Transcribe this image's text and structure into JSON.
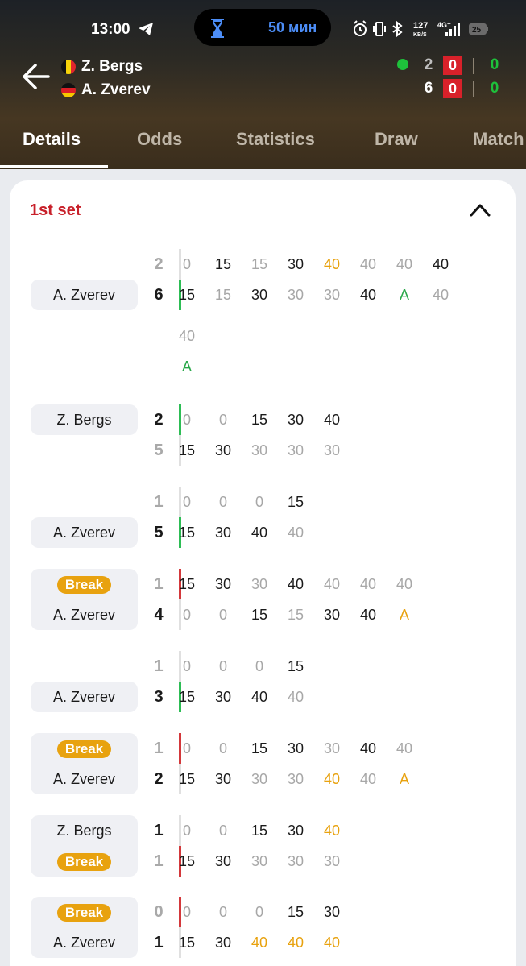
{
  "status_bar": {
    "time": "13:00",
    "timer_text": "50 мин",
    "network_speed": "127",
    "network_unit": "KB/S",
    "network_type": "4G⁺",
    "battery": "25",
    "icons": [
      "telegram-icon",
      "hourglass-icon",
      "alarm-icon",
      "vibrate-icon",
      "bluetooth-icon",
      "signal-icon",
      "battery-icon"
    ]
  },
  "match_header": {
    "back_icon": "arrow-left-icon",
    "players": [
      {
        "name": "Z. Bergs",
        "flag": "belgium-flag-icon",
        "flag_colors": [
          "#111111",
          "#f6d20a",
          "#e1262d"
        ],
        "sets": "2",
        "current_game": "0",
        "points": "0",
        "serving": true
      },
      {
        "name": "A. Zverev",
        "flag": "germany-flag-icon",
        "flag_colors": [
          "#111111",
          "#dd1f26",
          "#f6c800"
        ],
        "sets": "6",
        "current_game": "0",
        "points": "0",
        "serving": false
      }
    ]
  },
  "tabs": [
    {
      "label": "Details",
      "active": true
    },
    {
      "label": "Odds",
      "active": false
    },
    {
      "label": "Statistics",
      "active": false
    },
    {
      "label": "Draw",
      "active": false
    },
    {
      "label": "Match",
      "active": false
    }
  ],
  "set_section": {
    "title": "1st set",
    "collapse_icon": "chevron-up-icon",
    "break_label": "Break",
    "games": [
      {
        "top_label": "",
        "bottom_label": "A. Zverev",
        "top_num": "2",
        "bottom_num": "6",
        "bar": "green",
        "bar_row": "bottom",
        "top_points": [
          [
            "0",
            "g"
          ],
          [
            "15",
            "b"
          ],
          [
            "15",
            "g"
          ],
          [
            "30",
            "b"
          ],
          [
            "40",
            "o"
          ],
          [
            "40",
            "g"
          ],
          [
            "40",
            "g"
          ],
          [
            "40",
            "b"
          ]
        ],
        "bottom_points": [
          [
            "15",
            "b"
          ],
          [
            "15",
            "g"
          ],
          [
            "30",
            "b"
          ],
          [
            "30",
            "g"
          ],
          [
            "30",
            "g"
          ],
          [
            "40",
            "b"
          ],
          [
            "A",
            "gr"
          ],
          [
            "40",
            "g"
          ]
        ],
        "extra_top": [
          [
            "40",
            "g"
          ]
        ],
        "extra_bottom": [
          [
            "A",
            "gr"
          ]
        ]
      },
      {
        "top_label": "Z. Bergs",
        "bottom_label": "",
        "top_num": "2",
        "bottom_num": "5",
        "bar": "green",
        "bar_row": "top",
        "top_points": [
          [
            "0",
            "g"
          ],
          [
            "0",
            "g"
          ],
          [
            "15",
            "b"
          ],
          [
            "30",
            "b"
          ],
          [
            "40",
            "b"
          ]
        ],
        "bottom_points": [
          [
            "15",
            "b"
          ],
          [
            "30",
            "b"
          ],
          [
            "30",
            "g"
          ],
          [
            "30",
            "g"
          ],
          [
            "30",
            "g"
          ]
        ]
      },
      {
        "top_label": "",
        "bottom_label": "A. Zverev",
        "top_num": "1",
        "bottom_num": "5",
        "bar": "green",
        "bar_row": "bottom",
        "top_points": [
          [
            "0",
            "g"
          ],
          [
            "0",
            "g"
          ],
          [
            "0",
            "g"
          ],
          [
            "15",
            "b"
          ]
        ],
        "bottom_points": [
          [
            "15",
            "b"
          ],
          [
            "30",
            "b"
          ],
          [
            "40",
            "b"
          ],
          [
            "40",
            "g"
          ]
        ]
      },
      {
        "top_label": "Break",
        "bottom_label": "A. Zverev",
        "top_num": "1",
        "bottom_num": "4",
        "bar": "red",
        "bar_row": "top",
        "top_points": [
          [
            "15",
            "b"
          ],
          [
            "30",
            "b"
          ],
          [
            "30",
            "g"
          ],
          [
            "40",
            "b"
          ],
          [
            "40",
            "g"
          ],
          [
            "40",
            "g"
          ],
          [
            "40",
            "g"
          ]
        ],
        "bottom_points": [
          [
            "0",
            "g"
          ],
          [
            "0",
            "g"
          ],
          [
            "15",
            "b"
          ],
          [
            "15",
            "g"
          ],
          [
            "30",
            "b"
          ],
          [
            "40",
            "b"
          ],
          [
            "A",
            "o"
          ]
        ]
      },
      {
        "top_label": "",
        "bottom_label": "A. Zverev",
        "top_num": "1",
        "bottom_num": "3",
        "bar": "green",
        "bar_row": "bottom",
        "top_points": [
          [
            "0",
            "g"
          ],
          [
            "0",
            "g"
          ],
          [
            "0",
            "g"
          ],
          [
            "15",
            "b"
          ]
        ],
        "bottom_points": [
          [
            "15",
            "b"
          ],
          [
            "30",
            "b"
          ],
          [
            "40",
            "b"
          ],
          [
            "40",
            "g"
          ]
        ]
      },
      {
        "top_label": "Break",
        "bottom_label": "A. Zverev",
        "top_num": "1",
        "bottom_num": "2",
        "bar": "red",
        "bar_row": "top",
        "top_points": [
          [
            "0",
            "g"
          ],
          [
            "0",
            "g"
          ],
          [
            "15",
            "b"
          ],
          [
            "30",
            "b"
          ],
          [
            "30",
            "g"
          ],
          [
            "40",
            "b"
          ],
          [
            "40",
            "g"
          ]
        ],
        "bottom_points": [
          [
            "15",
            "b"
          ],
          [
            "30",
            "b"
          ],
          [
            "30",
            "g"
          ],
          [
            "30",
            "g"
          ],
          [
            "40",
            "o"
          ],
          [
            "40",
            "g"
          ],
          [
            "A",
            "o"
          ]
        ]
      },
      {
        "top_label": "Z. Bergs",
        "bottom_label": "Break",
        "top_num": "1",
        "bottom_num": "1",
        "bar": "red",
        "bar_row": "bottom",
        "top_points": [
          [
            "0",
            "g"
          ],
          [
            "0",
            "g"
          ],
          [
            "15",
            "b"
          ],
          [
            "30",
            "b"
          ],
          [
            "40",
            "o"
          ]
        ],
        "bottom_points": [
          [
            "15",
            "b"
          ],
          [
            "30",
            "b"
          ],
          [
            "30",
            "g"
          ],
          [
            "30",
            "g"
          ],
          [
            "30",
            "g"
          ]
        ]
      },
      {
        "top_label": "Break",
        "bottom_label": "A. Zverev",
        "top_num": "0",
        "bottom_num": "1",
        "bar": "red",
        "bar_row": "top",
        "top_points": [
          [
            "0",
            "g"
          ],
          [
            "0",
            "g"
          ],
          [
            "0",
            "g"
          ],
          [
            "15",
            "b"
          ],
          [
            "30",
            "b"
          ]
        ],
        "bottom_points": [
          [
            "15",
            "b"
          ],
          [
            "30",
            "b"
          ],
          [
            "40",
            "o"
          ],
          [
            "40",
            "o"
          ],
          [
            "40",
            "o"
          ]
        ]
      }
    ]
  }
}
